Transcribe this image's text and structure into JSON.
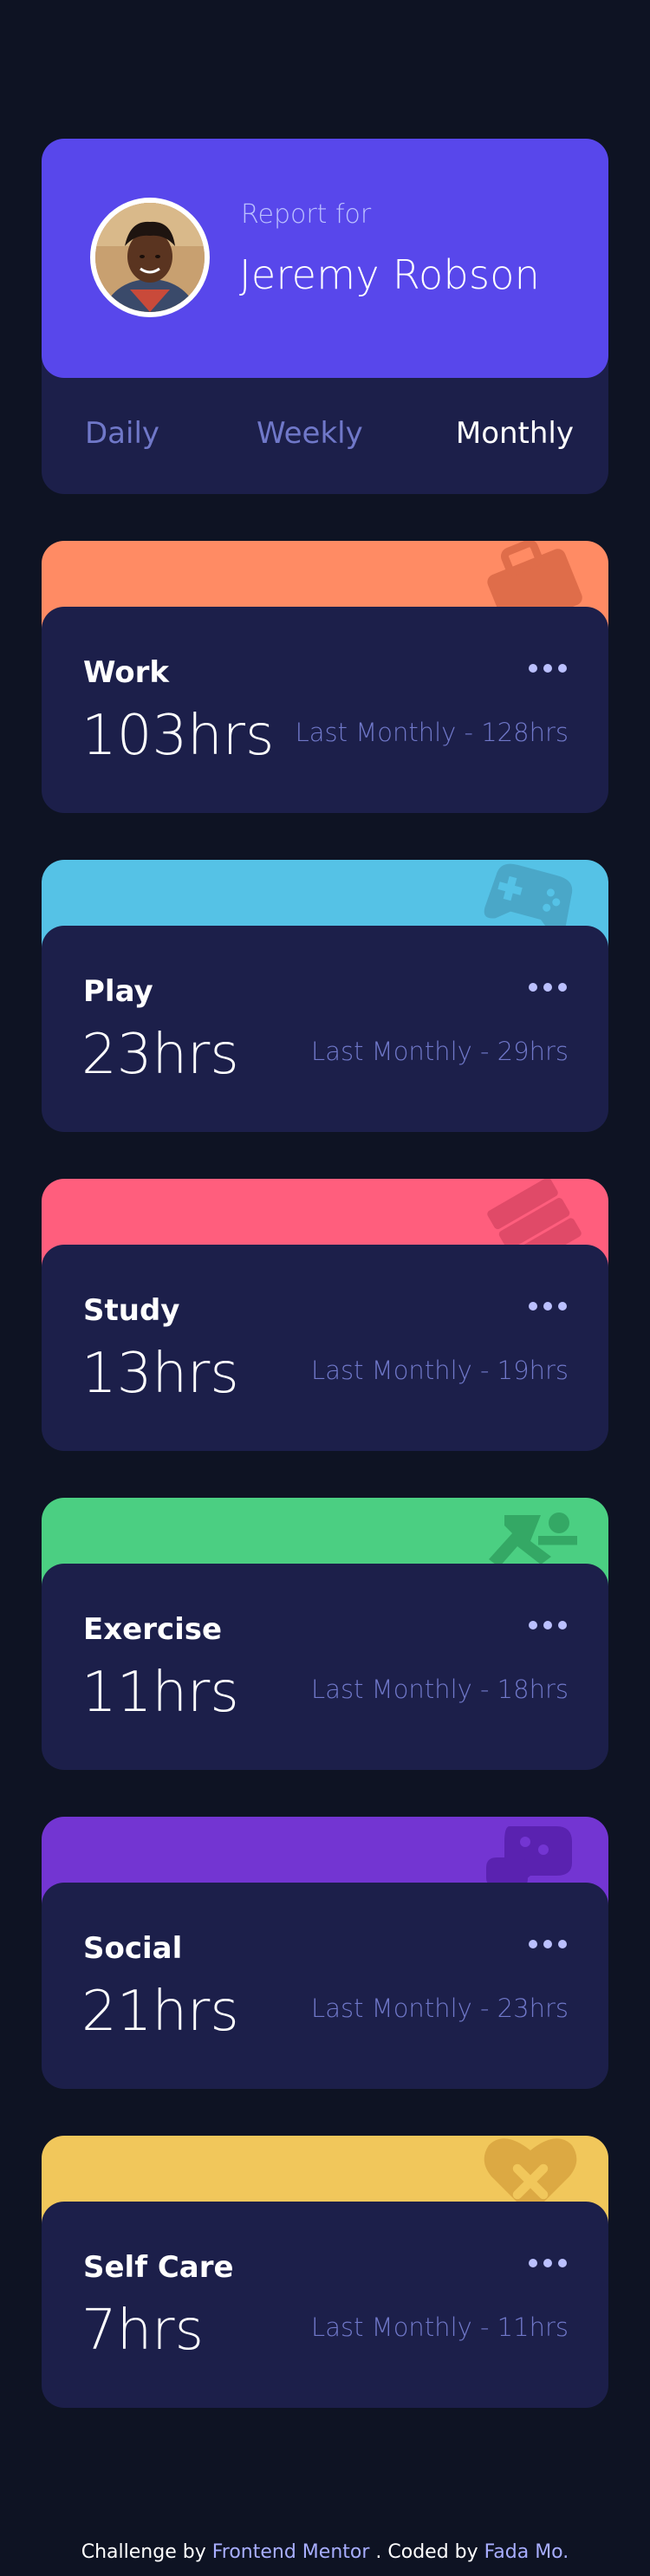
{
  "profile": {
    "report_label": "Report for",
    "name": "Jeremy Robson",
    "avatar_alt": "avatar"
  },
  "tabs": [
    {
      "label": "Daily",
      "active": false
    },
    {
      "label": "Weekly",
      "active": false
    },
    {
      "label": "Monthly",
      "active": true
    }
  ],
  "activities": [
    {
      "title": "Work",
      "hours": "103hrs",
      "previous": "Last Monthly - 128hrs",
      "color": "#ff8b64",
      "icon": "briefcase-icon"
    },
    {
      "title": "Play",
      "hours": "23hrs",
      "previous": "Last Monthly - 29hrs",
      "color": "#55c2e6",
      "icon": "gamepad-icon"
    },
    {
      "title": "Study",
      "hours": "13hrs",
      "previous": "Last Monthly - 19hrs",
      "color": "#ff5e7d",
      "icon": "books-icon"
    },
    {
      "title": "Exercise",
      "hours": "11hrs",
      "previous": "Last Monthly - 18hrs",
      "color": "#4bcf82",
      "icon": "running-icon"
    },
    {
      "title": "Social",
      "hours": "21hrs",
      "previous": "Last Monthly - 23hrs",
      "color": "#7335d2",
      "icon": "chat-bubbles-icon"
    },
    {
      "title": "Self Care",
      "hours": "7hrs",
      "previous": "Last Monthly - 11hrs",
      "color": "#f1c75b",
      "icon": "heart-icon"
    }
  ],
  "footer": {
    "prefix": "Challenge by",
    "link1": "Frontend Mentor",
    "middle": ". Coded by",
    "link2": "Fada Mo."
  }
}
